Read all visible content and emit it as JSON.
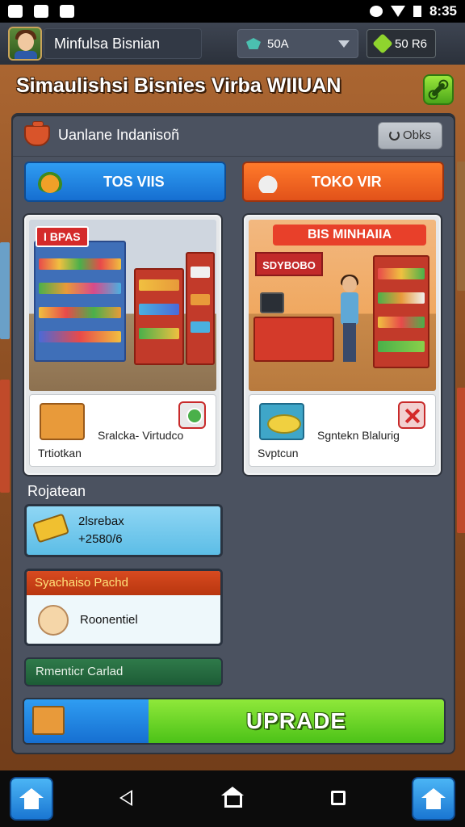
{
  "status_bar": {
    "time": "8:35"
  },
  "header": {
    "player_name": "Minfulsa Bisnian",
    "currency_label": "50A",
    "money_label": "50 R6"
  },
  "title": "Simaulishsi Bisnies Virba WIIUAN",
  "panel": {
    "title": "Uanlane Indanisoñ",
    "refresh_label": "Obks"
  },
  "tabs": [
    {
      "label": "TOS VIIS"
    },
    {
      "label": "TOKO VIR"
    }
  ],
  "stores": [
    {
      "sign": "I BPAS",
      "info_main": "Sralcka- Virtudco",
      "info_sub": "Trtiotkan"
    },
    {
      "banner": "BIS MINHAIIA",
      "counter_sign": "SDYBOBO",
      "info_main": "Sgntekn Blalurig",
      "info_sub": "Svptcun"
    }
  ],
  "section_label": "Rojatean",
  "stat": {
    "name": "2lsrebax",
    "value": "+2580/6"
  },
  "deal": {
    "header": "Syachaiso Pachd",
    "text": "Roonentiel"
  },
  "secondary_button": "Rmenticr Carlad",
  "upgrade_button": "UPRADE",
  "colors": {
    "primary_blue": "#166fd1",
    "primary_orange": "#e2521a",
    "upgrade_green": "#4cc218",
    "panel_bg": "#4b5260"
  },
  "icons": [
    "photo-icon",
    "wifi-icon",
    "battery-icon",
    "gem-icon",
    "money-icon",
    "wrench-icon",
    "pot-icon",
    "refresh-icon",
    "box-icon",
    "food-icon",
    "check-badge-icon",
    "close-badge-icon",
    "ticket-icon",
    "chick-icon",
    "home-icon",
    "back-icon",
    "recent-apps-icon"
  ]
}
